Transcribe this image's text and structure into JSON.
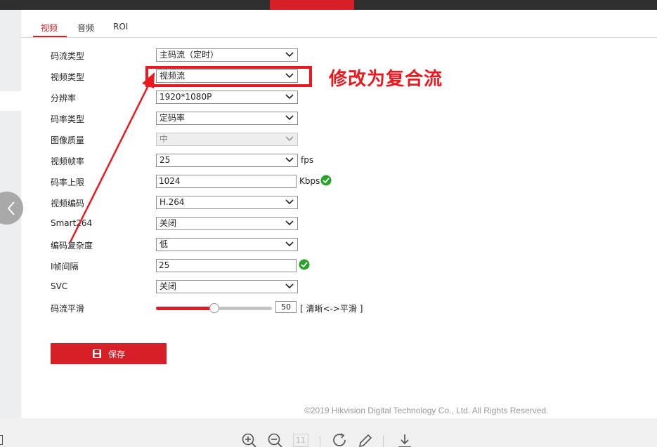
{
  "tabs": [
    {
      "label": "视频"
    },
    {
      "label": "音频"
    },
    {
      "label": "ROI"
    }
  ],
  "form": {
    "stream_type": {
      "label": "码流类型",
      "value": "主码流（定时）"
    },
    "video_type": {
      "label": "视频类型",
      "value": "视频流"
    },
    "resolution": {
      "label": "分辨率",
      "value": "1920*1080P"
    },
    "bitrate_type": {
      "label": "码率类型",
      "value": "定码率"
    },
    "image_quality": {
      "label": "图像质量",
      "value": "中"
    },
    "frame_rate": {
      "label": "视频帧率",
      "value": "25",
      "unit": "fps"
    },
    "max_bitrate": {
      "label": "码率上限",
      "value": "1024",
      "unit": "Kbps"
    },
    "video_encoding": {
      "label": "视频编码",
      "value": "H.264"
    },
    "smart264": {
      "label": "Smart264",
      "value": "关闭"
    },
    "encoding_complexity": {
      "label": "编码复杂度",
      "value": "低"
    },
    "i_frame_interval": {
      "label": "I帧间隔",
      "value": "25"
    },
    "svc": {
      "label": "SVC",
      "value": "关闭"
    },
    "smoothing": {
      "label": "码流平滑",
      "value": "50",
      "level": 50,
      "caption": "[ 清晰<->平滑 ]"
    }
  },
  "save_button": {
    "label": "保存"
  },
  "annotation": {
    "text": "修改为复合流"
  },
  "footer": {
    "copyright": "©2019 Hikvision Digital Technology Co., Ltd. All Rights Reserved."
  },
  "toolbar": {
    "page_number": "11"
  },
  "colors": {
    "accent": "#d71f27",
    "annotation": "#e8191f",
    "success": "#2aa32a"
  }
}
